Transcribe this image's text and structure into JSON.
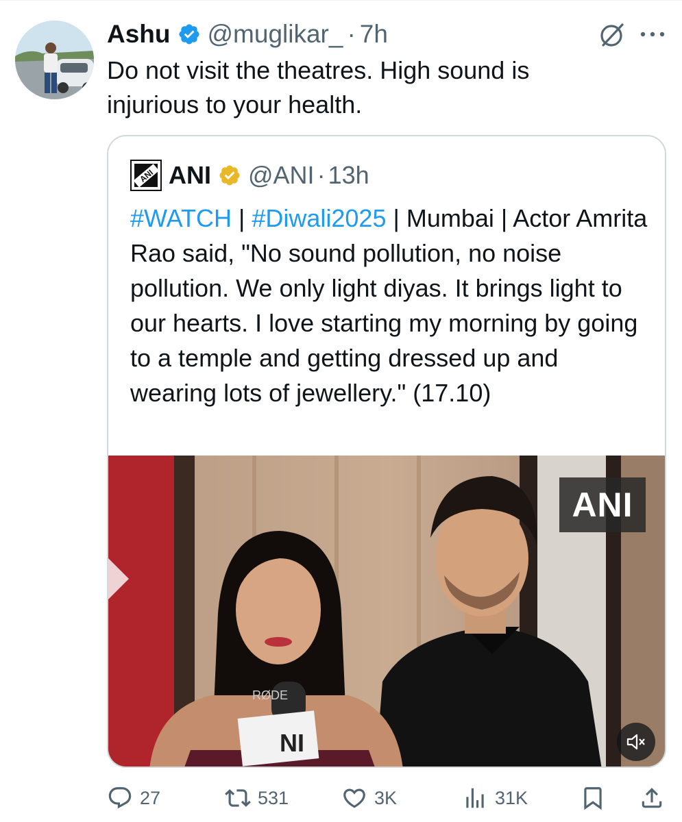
{
  "author": {
    "name": "Ashu",
    "handle": "@muglikar_",
    "separator": "·",
    "time": "7h",
    "verified": true,
    "verified_color": "#1d9bf0"
  },
  "tweet_text": "Do not visit the theatres. High sound is injurious to your health.",
  "quoted": {
    "name": "ANI",
    "handle": "@ANI",
    "separator": "·",
    "time": "13h",
    "verified": true,
    "verified_color": "#e8b828",
    "logo_text": "ANI",
    "text_parts": [
      {
        "text": "#WATCH",
        "type": "hashtag"
      },
      {
        "text": " | ",
        "type": "plain"
      },
      {
        "text": "#Diwali2025",
        "type": "hashtag"
      },
      {
        "text": " | Mumbai | Actor Amrita Rao said, \"No sound pollution, no noise pollution. We only light diyas. It brings light to our hearts. I love starting my morning by going to a temple and getting dressed up and wearing lots of jewellery.\" (17.10)",
        "type": "plain"
      }
    ],
    "video": {
      "watermark": "ANI",
      "mic_brand": "RØDE",
      "mic_flag": "NI",
      "muted": true
    }
  },
  "actions": {
    "replies": "27",
    "reposts": "531",
    "likes": "3K",
    "views": "31K"
  },
  "colors": {
    "link": "#1d9bf0",
    "secondary": "#536471",
    "border": "#cfd9de"
  }
}
